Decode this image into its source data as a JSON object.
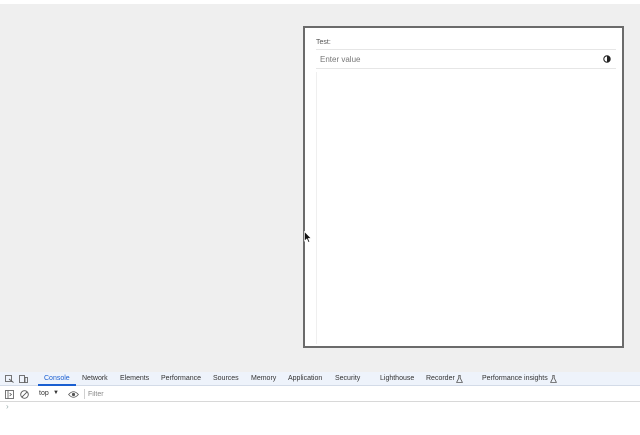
{
  "panel": {
    "label": "Test:",
    "input_value": "",
    "input_placeholder": "Enter value"
  },
  "icons": {
    "input_icon": "contrast-icon",
    "cursor": "mouse-pointer-icon"
  },
  "devtools": {
    "tabs": [
      {
        "label": "Console",
        "active": true
      },
      {
        "label": "Network"
      },
      {
        "label": "Elements"
      },
      {
        "label": "Performance"
      },
      {
        "label": "Sources"
      },
      {
        "label": "Memory"
      },
      {
        "label": "Application"
      },
      {
        "label": "Security"
      },
      {
        "label": "Lighthouse"
      },
      {
        "label": "Recorder"
      },
      {
        "label": "Performance insights"
      }
    ],
    "context": "top",
    "filter_placeholder": "Filter",
    "prompt_symbol": "›"
  },
  "colors": {
    "accent": "#1a5fd1",
    "page_bg": "#efefef",
    "panel_border": "#6b6b6b"
  }
}
